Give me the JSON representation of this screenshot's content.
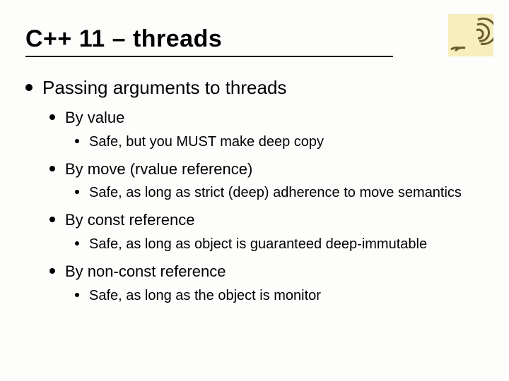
{
  "title": "C++ 11 – threads",
  "main": {
    "heading": "Passing arguments to threads",
    "items": [
      {
        "label": "By value",
        "sub": "Safe, but you MUST make deep copy"
      },
      {
        "label": "By move (rvalue reference)",
        "sub": "Safe, as long as strict (deep) adherence to move semantics"
      },
      {
        "label": "By const reference",
        "sub": "Safe, as long as object is guaranteed deep-immutable"
      },
      {
        "label": "By non-const reference",
        "sub": "Safe, as long as the object is monitor"
      }
    ]
  }
}
